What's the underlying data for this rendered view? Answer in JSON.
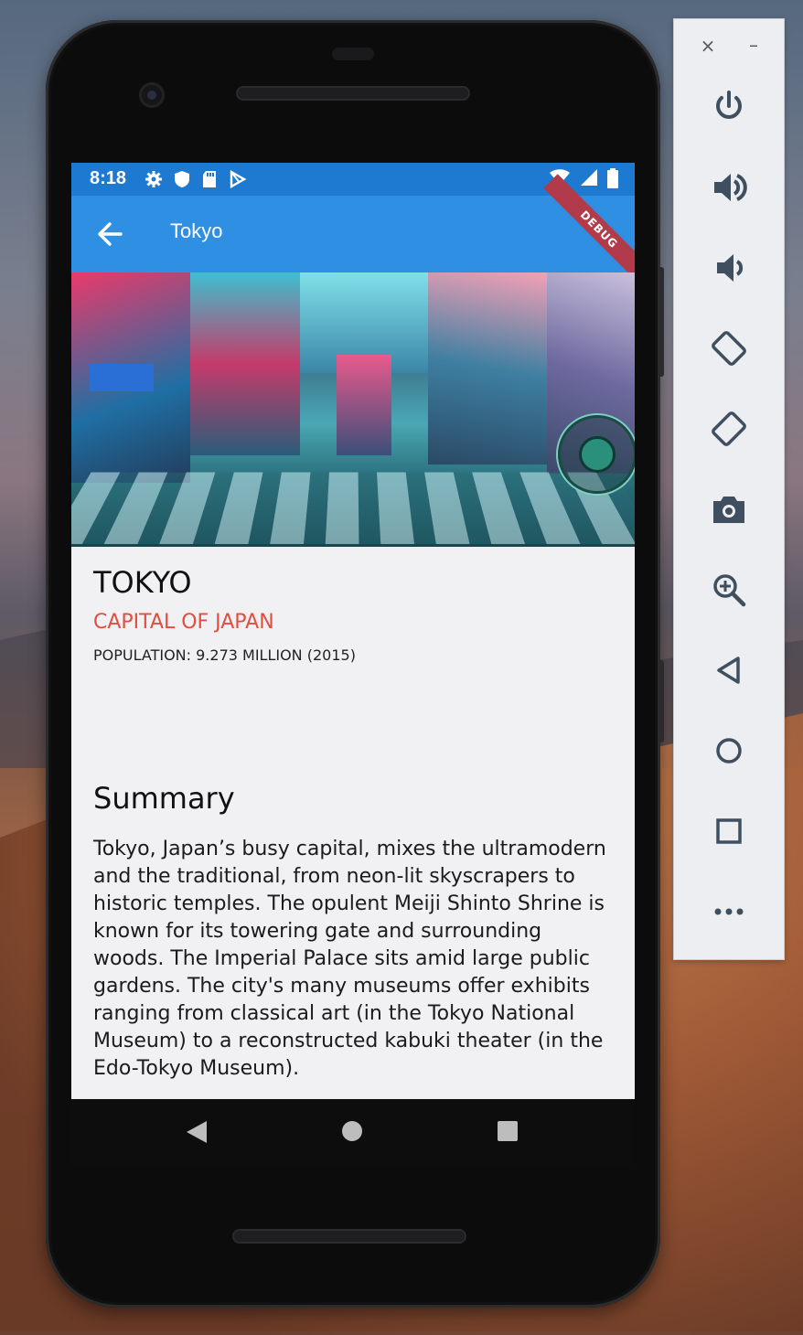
{
  "status_bar": {
    "time": "8:18"
  },
  "app_bar": {
    "title": "Tokyo",
    "debug_banner": "DEBUG"
  },
  "city": {
    "name": "TOKYO",
    "subtitle": "CAPITAL OF JAPAN",
    "population": "POPULATION: 9.273 MILLION (2015)"
  },
  "summary": {
    "heading": "Summary",
    "text": "Tokyo, Japan’s busy capital, mixes the ultramodern and the traditional, from neon-lit skyscrapers to historic temples. The opulent Meiji Shinto Shrine is known for its towering gate and surrounding woods. The Imperial Palace sits amid large public gardens. The city's many museums offer exhibits ranging from classical art (in the Tokyo National Museum) to a reconstructed kabuki theater (in the Edo-Tokyo Museum)."
  },
  "emulator_toolbar": {
    "close": "×",
    "minimize": "–",
    "icons": [
      "power-icon",
      "volume-up-icon",
      "volume-down-icon",
      "rotate-left-icon",
      "rotate-right-icon",
      "camera-icon",
      "zoom-icon",
      "back-icon",
      "home-icon",
      "overview-icon",
      "more-icon"
    ]
  },
  "colors": {
    "status_bar": "#1e7ad1",
    "app_bar": "#2f8fe3",
    "subtitle": "#e24d3f",
    "debug_banner": "#b23b4b"
  }
}
